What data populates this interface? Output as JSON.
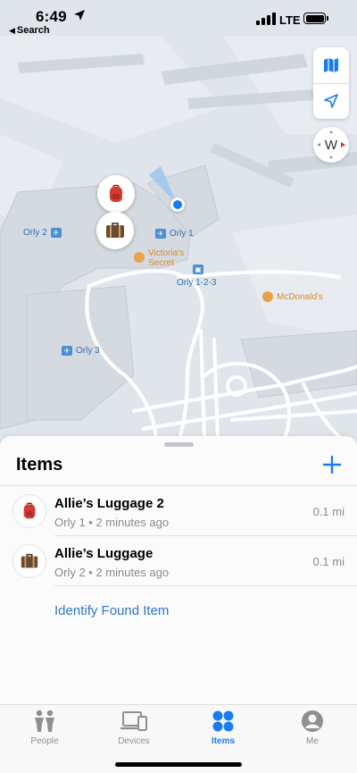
{
  "status_bar": {
    "time": "6:49",
    "back_label": "Search",
    "network": "LTE"
  },
  "map": {
    "compass_heading": "W",
    "labels": {
      "orly2": "Orly 2",
      "orly1": "Orly 1",
      "orly3": "Orly 3",
      "orly123": "Orly 1-2-3",
      "victorias_secret_line1": "Victoria's",
      "victorias_secret_line2": "Secret",
      "mcdonalds": "McDonald's"
    },
    "pins": [
      {
        "name": "backpack",
        "icon": "red-backpack-icon"
      },
      {
        "name": "suitcase",
        "icon": "brown-suitcase-icon"
      }
    ]
  },
  "sheet": {
    "title": "Items",
    "items": [
      {
        "name": "Allie’s Luggage 2",
        "subtitle": "Orly 1 • 2 minutes ago",
        "distance": "0.1 mi",
        "icon": "red-backpack-icon"
      },
      {
        "name": "Allie’s Luggage",
        "subtitle": "Orly 2 • 2 minutes ago",
        "distance": "0.1 mi",
        "icon": "brown-suitcase-icon"
      }
    ],
    "identify_label": "Identify Found Item"
  },
  "tabs": [
    {
      "label": "People",
      "icon": "people-icon",
      "active": false
    },
    {
      "label": "Devices",
      "icon": "devices-icon",
      "active": false
    },
    {
      "label": "Items",
      "icon": "items-icon",
      "active": true
    },
    {
      "label": "Me",
      "icon": "me-icon",
      "active": false
    }
  ],
  "colors": {
    "accent": "#1a7cf3",
    "map_bg": "#dfe5ea",
    "map_road": "#ffffff",
    "map_terminal": "#cdd4db"
  }
}
